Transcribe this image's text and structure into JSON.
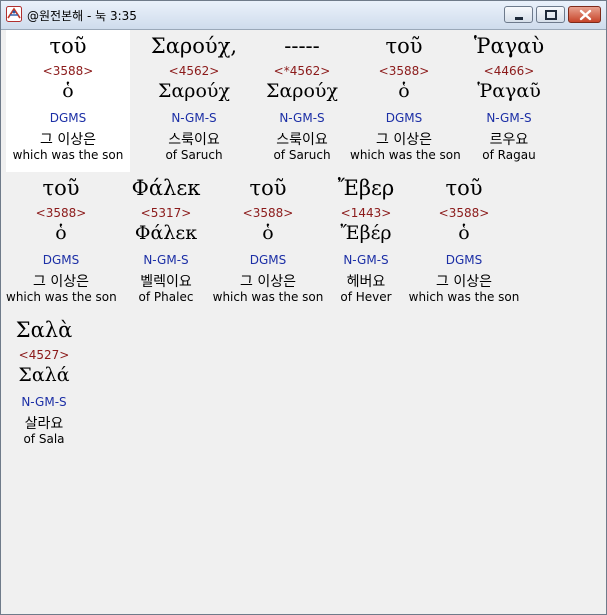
{
  "window": {
    "title": "@원전본해 - 눅 3:35",
    "icon": "app-logo-icon"
  },
  "words": [
    {
      "greek": "τοῦ",
      "strong": "<3588>",
      "lemma": "ὁ",
      "morph": "DGMS",
      "korean": "그 이상은",
      "english": "which was the son",
      "selected": true
    },
    {
      "greek": "Σαρούχ,",
      "strong": "<4562>",
      "lemma": "Σαρούχ",
      "morph": "N-GM-S",
      "korean": "스룩이요",
      "english": "of Saruch"
    },
    {
      "greek": "-----",
      "strong": "<*4562>",
      "lemma": "Σαρούχ",
      "morph": "N-GM-S",
      "korean": "스룩이요",
      "english": "of Saruch"
    },
    {
      "greek": "τοῦ",
      "strong": "<3588>",
      "lemma": "ὁ",
      "morph": "DGMS",
      "korean": "그 이상은",
      "english": "which was the son"
    },
    {
      "greek": "Ῥαγαὺ",
      "strong": "<4466>",
      "lemma": "Ῥαγαῦ",
      "morph": "N-GM-S",
      "korean": "르우요",
      "english": "of Ragau"
    },
    {
      "greek": "τοῦ",
      "strong": "<3588>",
      "lemma": "ὁ",
      "morph": "DGMS",
      "korean": "그 이상은",
      "english": "which was the son"
    },
    {
      "greek": "Φάλεκ",
      "strong": "<5317>",
      "lemma": "Φάλεκ",
      "morph": "N-GM-S",
      "korean": "벨렉이요",
      "english": "of Phalec"
    },
    {
      "greek": "τοῦ",
      "strong": "<3588>",
      "lemma": "ὁ",
      "morph": "DGMS",
      "korean": "그 이상은",
      "english": "which was the son"
    },
    {
      "greek": "Ἔβερ",
      "strong": "<1443>",
      "lemma": "Ἔβέρ",
      "morph": "N-GM-S",
      "korean": "헤버요",
      "english": "of Hever"
    },
    {
      "greek": "τοῦ",
      "strong": "<3588>",
      "lemma": "ὁ",
      "morph": "DGMS",
      "korean": "그 이상은",
      "english": "which was the son"
    },
    {
      "greek": "Σαλὰ",
      "strong": "<4527>",
      "lemma": "Σαλά",
      "morph": "N-GM-S",
      "korean": "살라요",
      "english": "of Sala"
    }
  ]
}
